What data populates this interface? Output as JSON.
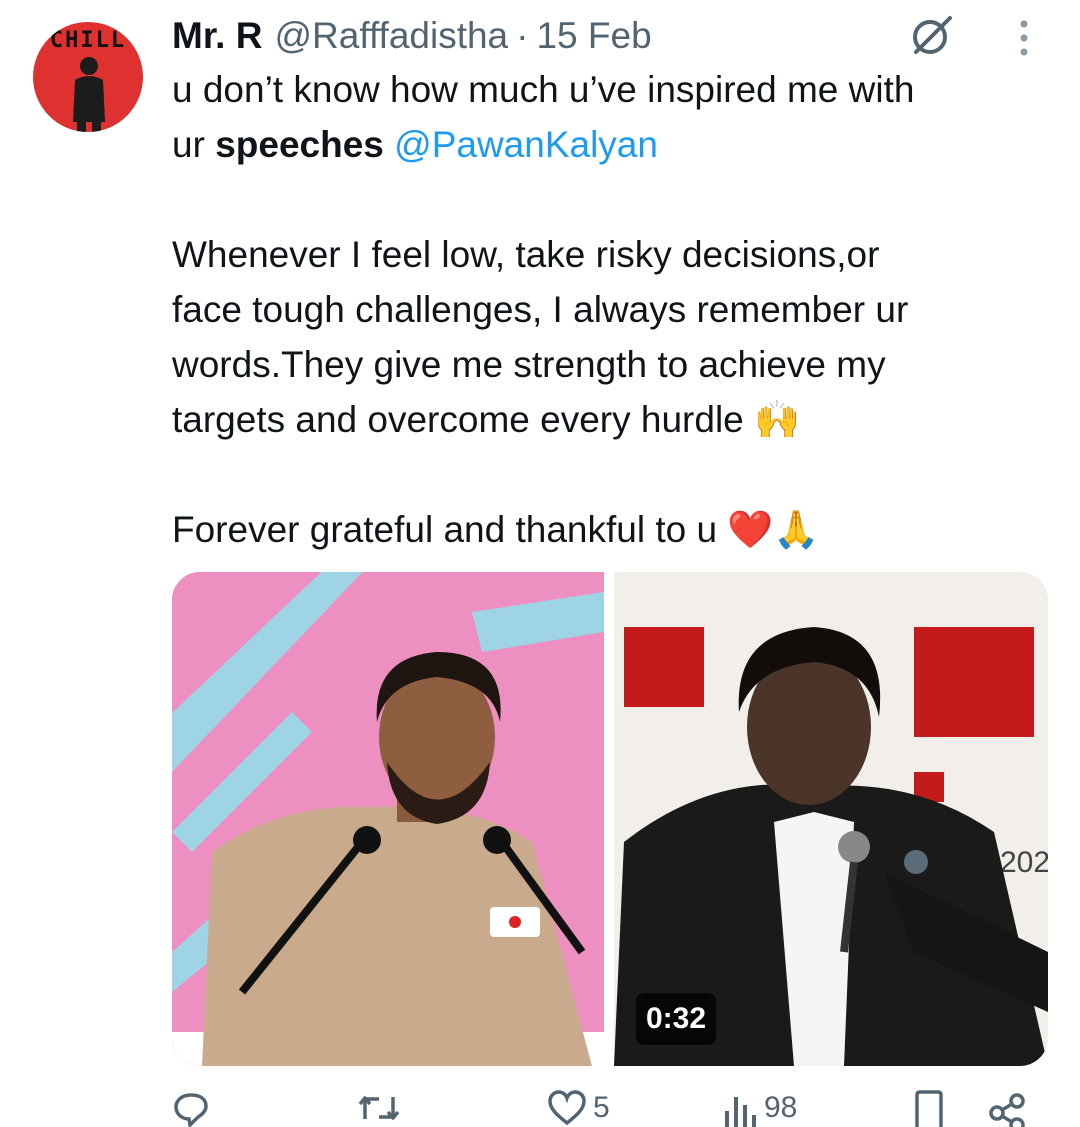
{
  "tweet": {
    "author_name": "Mr. R",
    "author_handle": "@Rafffadistha",
    "separator": "·",
    "date": "15 Feb",
    "avatar_text": "CHILL",
    "text_line1": "u don’t know how much u’ve inspired me with",
    "text_line2_prefix": "ur ",
    "text_line2_bold": "speeches",
    "text_line2_mention": "@PawanKalyan",
    "para2_line1": "Whenever I feel low, take risky decisions,or",
    "para2_line2": "face tough challenges, I always remember ur",
    "para2_line3": "words.They give me strength to achieve my",
    "para2_line4": "targets and overcome every hurdle 🙌",
    "para3": "Forever grateful and thankful to u ❤️🙏"
  },
  "media": {
    "video_duration": "0:32",
    "banner_right_text": "202"
  },
  "actions": {
    "likes": "5",
    "views": "98"
  },
  "colors": {
    "accent": "#1d9bf0",
    "secondary_text": "#536471",
    "avatar_bg": "#e03131"
  },
  "icons": [
    "grok-icon",
    "more-icon",
    "reply-icon",
    "retweet-icon",
    "like-icon",
    "views-icon",
    "bookmark-icon",
    "share-icon"
  ]
}
